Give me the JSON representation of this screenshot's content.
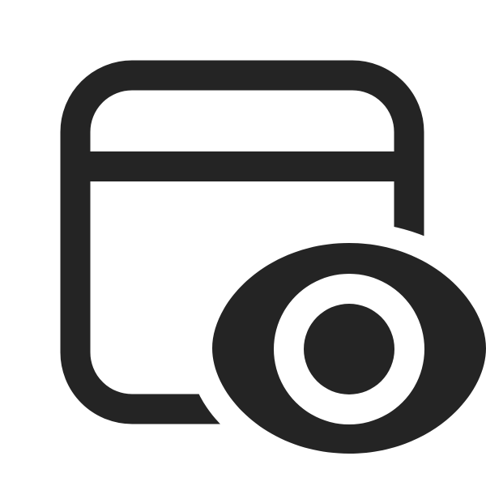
{
  "icon": {
    "name": "window-eye-icon",
    "parts": [
      "window-frame",
      "title-bar-divider",
      "eye-outline",
      "eye-pupil"
    ]
  },
  "colors": {
    "foreground": "#242424",
    "background": "#ffffff"
  }
}
